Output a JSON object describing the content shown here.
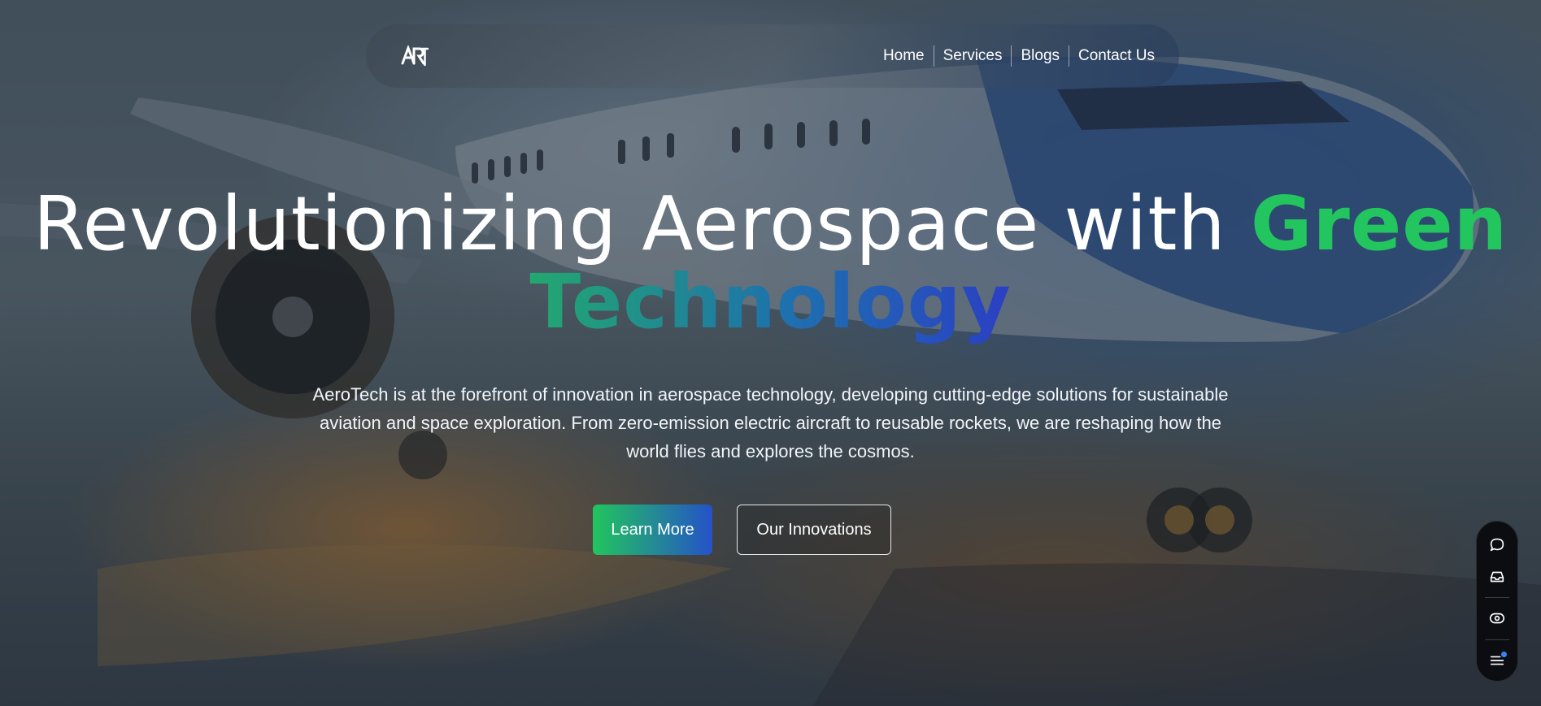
{
  "brand": {
    "logo_text": "ART"
  },
  "nav": {
    "items": [
      {
        "label": "Home"
      },
      {
        "label": "Services"
      },
      {
        "label": "Blogs"
      },
      {
        "label": "Contact Us"
      }
    ]
  },
  "hero": {
    "title_plain": "Revolutionizing Aerospace with",
    "title_green": "Green",
    "title_gradient": "Technology",
    "description": "AeroTech is at the forefront of innovation in aerospace technology, developing cutting-edge solutions for sustainable aviation and space exploration. From zero-emission electric aircraft to reusable rockets, we are reshaping how the world flies and explores the cosmos.",
    "primary_button": "Learn More",
    "secondary_button": "Our Innovations"
  },
  "colors": {
    "accent_green": "#22c55e",
    "accent_blue": "#2552c8",
    "toolbar_bg": "#0b0d10"
  },
  "side_toolbar": {
    "icons": [
      "chat-bubble-icon",
      "inbox-icon",
      "eye-icon",
      "menu-icon"
    ]
  }
}
